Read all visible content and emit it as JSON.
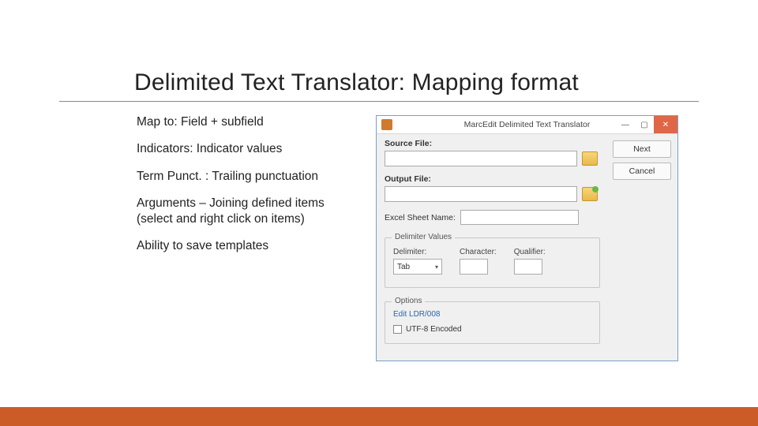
{
  "title": "Delimited Text Translator: Mapping format",
  "bullets": {
    "b1": "Map to: Field + subfield",
    "b2": "Indicators:  Indicator values",
    "b3": "Term Punct. :  Trailing punctuation",
    "b4": "Arguments – Joining defined items (select and right click on items)",
    "b5": "Ability to save templates"
  },
  "dialog": {
    "window_title": "MarcEdit Delimited Text Translator",
    "buttons": {
      "next": "Next",
      "cancel": "Cancel"
    },
    "labels": {
      "source": "Source File:",
      "output": "Output File:",
      "sheet": "Excel Sheet Name:",
      "delim_group": "Delimiter Values",
      "delimiter": "Delimiter:",
      "character": "Character:",
      "qualifier": "Qualifier:",
      "options_group": "Options",
      "edit_link": "Edit LDR/008",
      "utf8": "UTF-8 Encoded"
    },
    "values": {
      "delimiter_selected": "Tab"
    }
  }
}
